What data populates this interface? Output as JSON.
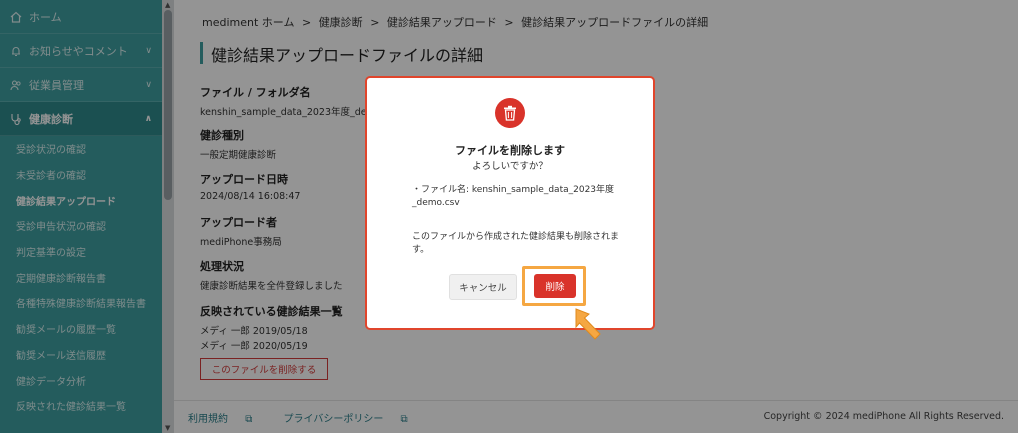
{
  "sidebar": {
    "items": [
      {
        "label": "ホーム",
        "icon": "home-icon"
      },
      {
        "label": "お知らせやコメント",
        "icon": "bell-icon"
      },
      {
        "label": "従業員管理",
        "icon": "people-icon"
      },
      {
        "label": "健康診断",
        "icon": "stethoscope-icon"
      }
    ],
    "sub_items": [
      "受診状況の確認",
      "未受診者の確認",
      "健診結果アップロード",
      "受診申告状況の確認",
      "判定基準の設定",
      "定期健康診断報告書",
      "各種特殊健康診断結果報告書",
      "勧奨メールの履歴一覧",
      "勧奨メール送信履歴",
      "健診データ分析",
      "反映された健診結果一覧"
    ]
  },
  "breadcrumb": {
    "home": "mediment ホーム",
    "sep": ">",
    "level1": "健康診断",
    "level2": "健診結果アップロード",
    "current": "健診結果アップロードファイルの詳細"
  },
  "page": {
    "title": "健診結果アップロードファイルの詳細",
    "file_label": "ファイル / フォルダ名",
    "file_value": "kenshin_sample_data_2023年度_dem",
    "type_label": "健診種別",
    "type_value": "一般定期健康診断",
    "date_label": "アップロード日時",
    "date_value": "2024/08/14 16:08:47",
    "uploader_label": "アップロード者",
    "uploader_value": "mediPhone事務局",
    "status_label": "処理状況",
    "status_value": "健康診断結果を全件登録しました",
    "results_label": "反映されている健診結果一覧",
    "results": [
      "メディ 一郎 2019/05/18",
      "メディ 一郎 2020/05/19"
    ],
    "delete_file_button": "このファイルを削除する"
  },
  "footer": {
    "terms": "利用規約",
    "privacy": "プライバシーポリシー",
    "copyright": "Copyright © 2024 mediPhone All Rights Reserved."
  },
  "modal": {
    "title": "ファイルを削除します",
    "subtitle": "よろしいですか？",
    "file_line": "・ファイル名: kenshin_sample_data_2023年度_demo.csv",
    "note": "このファイルから作成された健診結果も削除されます。",
    "cancel": "キャンセル",
    "delete": "削除"
  },
  "colors": {
    "sidebar": "#3f9fa1",
    "accent": "#d9332a",
    "highlight": "#f5a742"
  }
}
